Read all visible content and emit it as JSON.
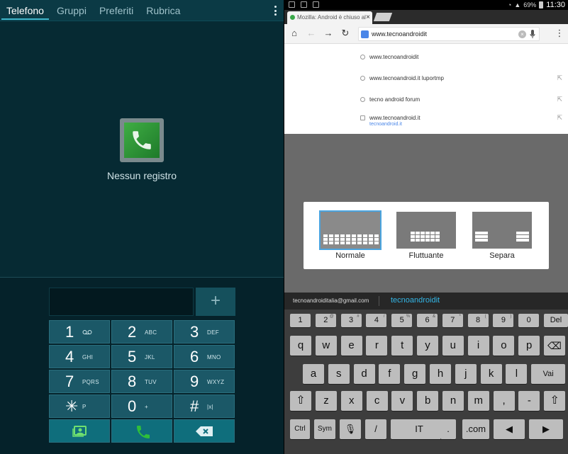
{
  "phone": {
    "tabs": [
      "Telefono",
      "Gruppi",
      "Preferiti",
      "Rubrica"
    ],
    "empty_text": "Nessun registro",
    "add_label": "+",
    "keys": [
      {
        "d": "1",
        "l": "⓪⓪"
      },
      {
        "d": "2",
        "l": "ABC"
      },
      {
        "d": "3",
        "l": "DEF"
      },
      {
        "d": "4",
        "l": "GHI"
      },
      {
        "d": "5",
        "l": "JKL"
      },
      {
        "d": "6",
        "l": "MNO"
      },
      {
        "d": "7",
        "l": "PQRS"
      },
      {
        "d": "8",
        "l": "TUV"
      },
      {
        "d": "9",
        "l": "WXYZ"
      },
      {
        "d": "✳",
        "l": "P"
      },
      {
        "d": "0",
        "l": "+"
      },
      {
        "d": "#",
        "l": "|x|"
      }
    ]
  },
  "browser": {
    "status": {
      "battery": "69%",
      "time": "11:30"
    },
    "tab_title": "Mozilla: Android è chiuso al",
    "url": "www.tecnoandroidit",
    "suggestions": [
      {
        "text": "www.tecnoandroidit",
        "sub": ""
      },
      {
        "text": "www.tecnoandroid.it luportmp",
        "sub": ""
      },
      {
        "text": "tecno android forum",
        "sub": ""
      },
      {
        "text": "www.tecnoandroid.it",
        "sub": "tecnoandroid.it"
      }
    ],
    "keyboard_types": [
      "Normale",
      "Fluttuante",
      "Separa"
    ]
  },
  "keyboard": {
    "email": "tecnoandroiditalia@gmail.com",
    "suggestion": "tecnoandroidit",
    "row1": [
      "1",
      "2",
      "3",
      "4",
      "5",
      "6",
      "7",
      "8",
      "9",
      "0",
      "Del"
    ],
    "row1_sup": [
      "",
      "@",
      "#",
      "/",
      "%",
      "&",
      "*",
      "(",
      ")",
      "",
      ""
    ],
    "row2": [
      "q",
      "w",
      "e",
      "r",
      "t",
      "y",
      "u",
      "i",
      "o",
      "p",
      "⌫"
    ],
    "row3": [
      "a",
      "s",
      "d",
      "f",
      "g",
      "h",
      "j",
      "k",
      "l",
      "Vai"
    ],
    "row4": [
      "⇧",
      "z",
      "x",
      "c",
      "v",
      "b",
      "n",
      "m",
      ",",
      "-",
      "⇧"
    ],
    "row5": [
      "Ctrl",
      "Sym",
      "🎙",
      "/",
      "IT",
      ".",
      ".com",
      "◀",
      "▶"
    ]
  },
  "colors": {
    "accent": "#3fb6cc",
    "keypad": "#1b5867",
    "call": "#2fbf3a",
    "link": "#33b5e5"
  }
}
